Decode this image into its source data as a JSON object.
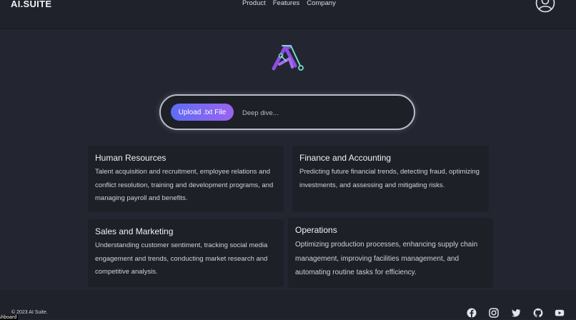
{
  "header": {
    "brand": "AI.SUITE",
    "nav": [
      "Product",
      "Features",
      "Company"
    ]
  },
  "search": {
    "upload_label": "Upload .txt File",
    "placeholder": "Deep dive..."
  },
  "cards": [
    {
      "title": "Human Resources",
      "text": "Talent acquisition and recruitment, employee relations and conflict resolution, training and development programs, and managing payroll and benefits."
    },
    {
      "title": "Finance and Accounting",
      "text": "Predicting future financial trends, detecting fraud, optimizing investments, and assessing and mitigating risks."
    },
    {
      "title": "Sales and Marketing",
      "text": "Understanding customer sentiment, tracking social media engagement and trends, conducting market research and competitive analysis."
    },
    {
      "title": "Operations",
      "text": "Optimizing production processes, enhancing supply chain management, improving facilities management, and automating routine tasks for efficiency."
    }
  ],
  "footer": {
    "copyright": "© 2023 AI Suite.",
    "overlay_label": "shboard",
    "social_icons": [
      "facebook-icon",
      "instagram-icon",
      "twitter-icon",
      "github-icon",
      "youtube-icon"
    ]
  },
  "colors": {
    "background": "#232630",
    "card": "#1d2027",
    "button_gradient_start": "#5f6cf4",
    "button_gradient_end": "#9a63f0",
    "logo_purple": "#8b4fe0",
    "logo_teal": "#78dcd0"
  }
}
